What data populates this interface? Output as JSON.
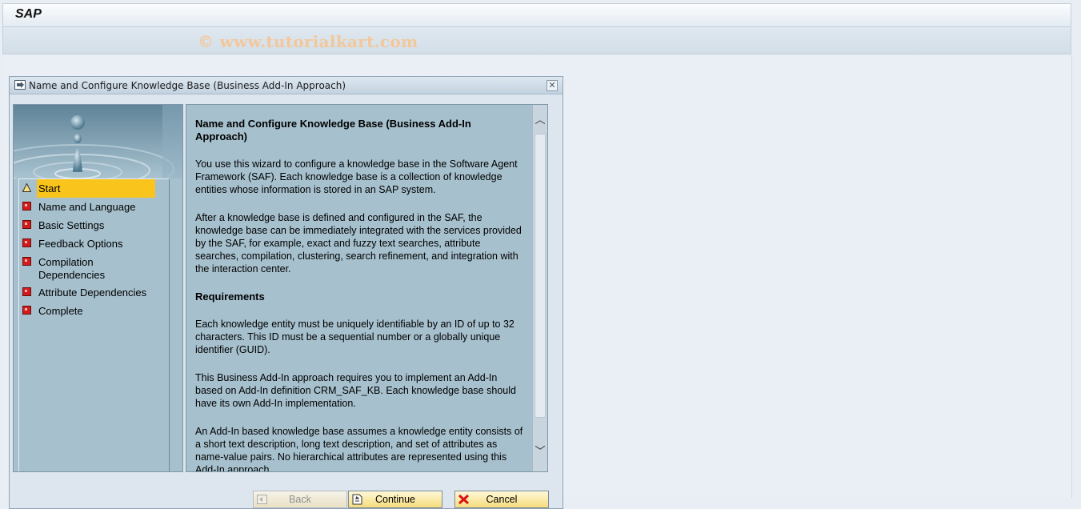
{
  "app": {
    "title": "SAP"
  },
  "watermark": "© www.tutorialkart.com",
  "dialog": {
    "title": "Name and Configure Knowledge Base (Business Add-In Approach)",
    "close_icon": "close-icon",
    "steps": [
      {
        "label": "Start",
        "icon": "warning-triangle-icon",
        "active": true
      },
      {
        "label": "Name and Language",
        "icon": "red-status-icon"
      },
      {
        "label": "Basic Settings",
        "icon": "red-status-icon"
      },
      {
        "label": "Feedback Options",
        "icon": "red-status-icon"
      },
      {
        "label": "Compilation Dependencies",
        "icon": "red-status-icon"
      },
      {
        "label": "Attribute Dependencies",
        "icon": "red-status-icon"
      },
      {
        "label": "Complete",
        "icon": "red-status-icon"
      }
    ],
    "content": {
      "heading": "Name and Configure Knowledge Base (Business Add-In Approach)",
      "para1": "You use this wizard to configure a knowledge base in the Software Agent Framework (SAF). Each knowledge base is a collection of knowledge entities whose information is stored in an SAP system.",
      "para2": "After a knowledge base is defined and configured in the SAF, the knowledge base can be immediately integrated with the services provided by the SAF, for example, exact and fuzzy text searches, attribute searches, compilation, clustering, search refinement, and integration with the interaction center.",
      "requirements_heading": "Requirements",
      "para3": "Each knowledge entity must be uniquely identifiable by an ID of up to 32 characters. This ID must be a sequential number or a globally unique identifier (GUID).",
      "para4": "This Business Add-In approach requires you to implement an Add-In based on Add-In definition CRM_SAF_KB. Each knowledge base should have its own Add-In implementation.",
      "para5": "An Add-In based knowledge base assumes a knowledge entity consists of a short text description, long text description, and set of attributes as name-value pairs. No hierarchical attributes are represented using this Add-In approach."
    },
    "buttons": {
      "back": "Back",
      "continue": "Continue",
      "cancel": "Cancel"
    }
  },
  "colors": {
    "accent": "#f9c41b",
    "panel": "#a6c0cd"
  }
}
